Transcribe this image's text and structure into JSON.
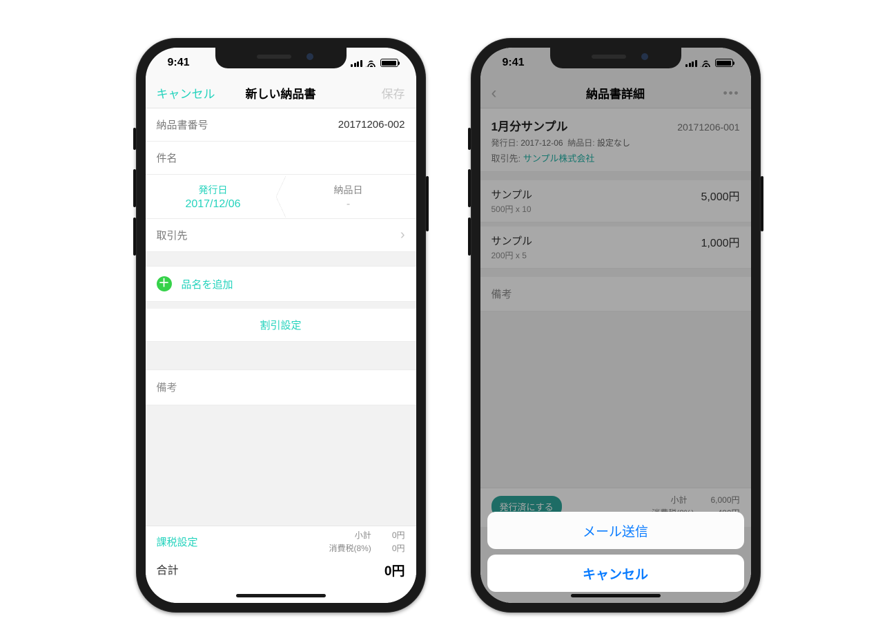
{
  "statusbar": {
    "time": "9:41"
  },
  "phone1": {
    "nav": {
      "cancel": "キャンセル",
      "title": "新しい納品書",
      "save": "保存"
    },
    "rows": {
      "doc_no_label": "納品書番号",
      "doc_no_value": "20171206-002",
      "subject_label": "件名",
      "issue_date_label": "発行日",
      "issue_date_value": "2017/12/06",
      "delivery_date_label": "納品日",
      "delivery_date_value": "-",
      "client_label": "取引先",
      "add_item": "品名を追加",
      "discount": "割引設定",
      "notes_label": "備考"
    },
    "footer": {
      "tax_settings": "課税設定",
      "subtotal_label": "小計",
      "subtotal_value": "0円",
      "tax_label": "消費税(8%)",
      "tax_value": "0円",
      "total_label": "合計",
      "total_value": "0円"
    }
  },
  "phone2": {
    "nav": {
      "title": "納品書詳細",
      "more": "•••"
    },
    "header": {
      "title": "1月分サンプル",
      "doc_no": "20171206-001",
      "issue_label": "発行日:",
      "issue_value": "2017-12-06",
      "deliv_label": "納品日:",
      "deliv_value": "設定なし",
      "client_label": "取引先:",
      "client_value": "サンプル株式会社"
    },
    "items": [
      {
        "name": "サンプル",
        "detail": "500円 x 10",
        "price": "5,000円"
      },
      {
        "name": "サンプル",
        "detail": "200円 x 5",
        "price": "1,000円"
      }
    ],
    "notes_label": "備考",
    "footer": {
      "issued_btn": "発行済にする",
      "subtotal_label": "小計",
      "subtotal_value": "6,000円",
      "tax_label": "消費税(8%)",
      "tax_value": "480円"
    },
    "sheet": {
      "mail": "メール送信",
      "cancel": "キャンセル"
    }
  }
}
